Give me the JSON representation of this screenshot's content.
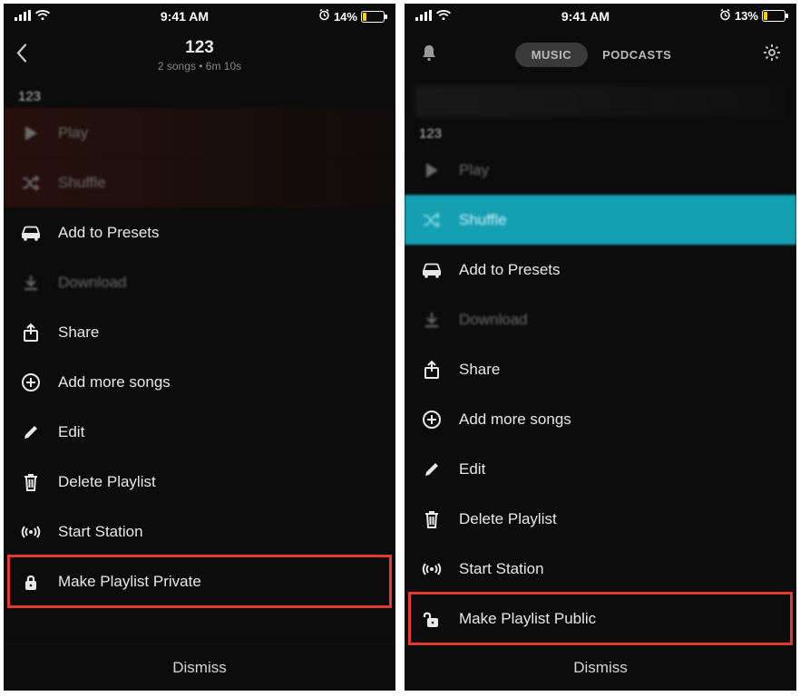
{
  "status": {
    "time": "9:41 AM",
    "battery_left": "14%",
    "battery_right": "13%"
  },
  "left": {
    "header": {
      "title": "123",
      "subtitle": "2 songs • 6m 10s"
    },
    "playlist_title": "123",
    "items": {
      "play": "Play",
      "shuffle": "Shuffle",
      "presets": "Add to Presets",
      "download": "Download",
      "share": "Share",
      "addmore": "Add more songs",
      "edit": "Edit",
      "delete": "Delete Playlist",
      "station": "Start Station",
      "privacy": "Make Playlist Private"
    },
    "dismiss": "Dismiss"
  },
  "right": {
    "tabs": {
      "music": "MUSIC",
      "podcasts": "PODCASTS"
    },
    "playlist_title": "123",
    "items": {
      "play": "Play",
      "shuffle": "Shuffle",
      "presets": "Add to Presets",
      "download": "Download",
      "share": "Share",
      "addmore": "Add more songs",
      "edit": "Edit",
      "delete": "Delete Playlist",
      "station": "Start Station",
      "privacy": "Make Playlist Public"
    },
    "dismiss": "Dismiss"
  },
  "colors": {
    "highlight": "#e23b2e",
    "battery": "#ffce00",
    "accent_teal": "#159fb3"
  }
}
